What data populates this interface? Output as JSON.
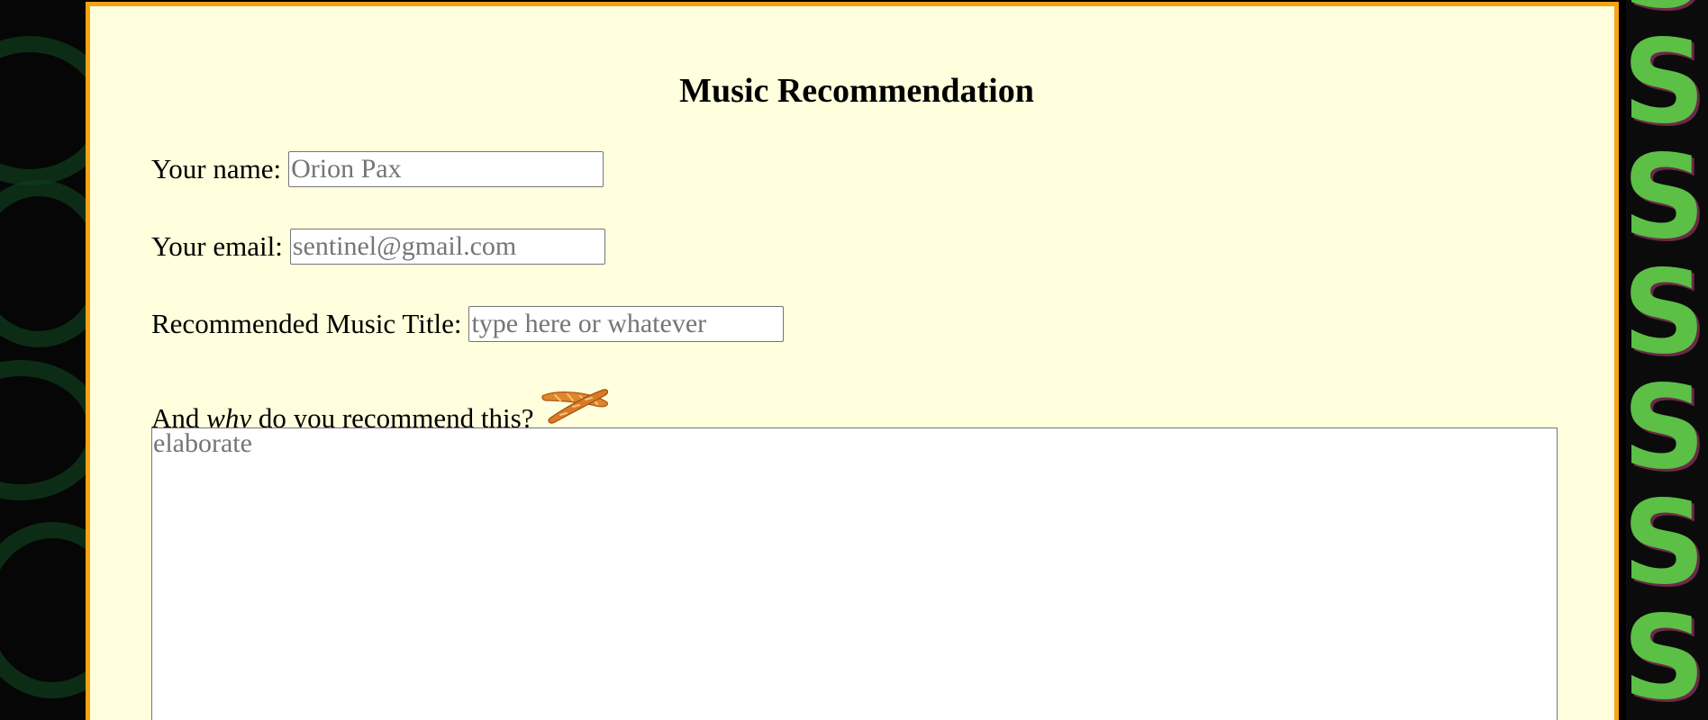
{
  "form": {
    "title": "Music Recommendation",
    "name": {
      "label": "Your name:",
      "value": "",
      "placeholder": "Orion Pax"
    },
    "email": {
      "label": "Your email:",
      "value": "",
      "placeholder": "sentinel@gmail.com"
    },
    "music_title": {
      "label": "Recommended Music Title:",
      "value": "",
      "placeholder": "type here or whatever"
    },
    "why": {
      "label_before": "And ",
      "label_emphasis": "why",
      "label_after": " do you recommend this?",
      "placeholder": "elaborate",
      "icon": "baguette-icon"
    }
  },
  "background": {
    "right_text": "Sp",
    "colors": {
      "panel": "#ffffdd",
      "panel_border": "#f5a315",
      "right_text": "#5cbf46",
      "left_rings": "#0f3a1c"
    }
  }
}
